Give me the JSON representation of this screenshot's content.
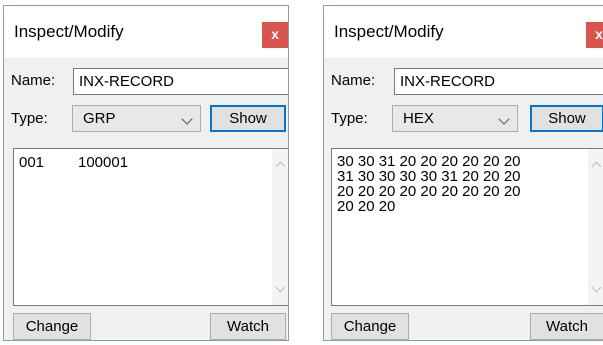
{
  "left": {
    "title": "Inspect/Modify",
    "close_label": "x",
    "name_label": "Name:",
    "name_value": "INX-RECORD",
    "type_label": "Type:",
    "type_value": "GRP",
    "show_label": "Show",
    "rows": [
      {
        "col1": "001",
        "col2": "100001"
      }
    ],
    "change_label": "Change",
    "watch_label": "Watch"
  },
  "right": {
    "title": "Inspect/Modify",
    "close_label": "x",
    "name_label": "Name:",
    "name_value": "INX-RECORD",
    "type_label": "Type:",
    "type_value": "HEX",
    "show_label": "Show",
    "lines": [
      "30 30 31 20 20 20 20 20 20",
      "31 30 30 30 30 31 20 20 20",
      "20 20 20 20 20 20 20 20 20",
      "20 20 20"
    ],
    "change_label": "Change",
    "watch_label": "Watch"
  }
}
